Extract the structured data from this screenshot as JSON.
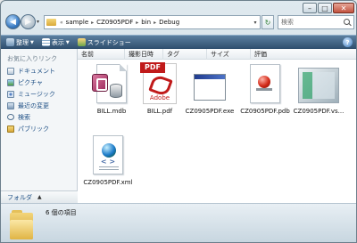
{
  "window": {
    "buttons": {
      "minimize": "–",
      "maximize": "□",
      "close": "✕"
    }
  },
  "navigation": {
    "back_glyph": "◀",
    "forward_glyph": "▶",
    "dropdown_glyph": "▾"
  },
  "address": {
    "prefix": "«",
    "crumbs": [
      "sample",
      "CZ0905PDF",
      "bin",
      "Debug"
    ],
    "separator": "▸",
    "dropdown_glyph": "▾",
    "refresh_glyph": "↻"
  },
  "search": {
    "placeholder": "検索"
  },
  "commandbar": {
    "organize": "整理",
    "views": "表示",
    "slideshow": "スライドショー",
    "caret": "▼",
    "help": "?"
  },
  "navpane": {
    "title": "お気に入りリンク",
    "items": [
      {
        "label": "ドキュメント",
        "icon": "documents-icon"
      },
      {
        "label": "ピクチャ",
        "icon": "pictures-icon"
      },
      {
        "label": "ミュージック",
        "icon": "music-icon"
      },
      {
        "label": "最近の変更",
        "icon": "recent-changes-icon"
      },
      {
        "label": "検索",
        "icon": "search-folder-icon"
      },
      {
        "label": "パブリック",
        "icon": "public-folder-icon"
      }
    ],
    "folders_label": "フォルダ",
    "folders_caret": "▲"
  },
  "columns": [
    "名前",
    "撮影日時",
    "タグ",
    "サイズ",
    "評価"
  ],
  "files": [
    {
      "name": "BILL.mdb",
      "icon": "access-database-icon"
    },
    {
      "name": "BILL.pdf",
      "icon": "pdf-icon",
      "badge": "PDF",
      "brand": "Adobe"
    },
    {
      "name": "CZ0905PDF.exe",
      "icon": "application-window-icon"
    },
    {
      "name": "CZ0905PDF.pdb",
      "icon": "program-database-icon"
    },
    {
      "name": "CZ0905PDF.vs...",
      "icon": "visual-studio-host-icon"
    },
    {
      "name": "CZ0905PDF.xml",
      "icon": "xml-document-icon",
      "tag": "< >"
    }
  ],
  "status": {
    "item_count": "6 個の項目"
  }
}
